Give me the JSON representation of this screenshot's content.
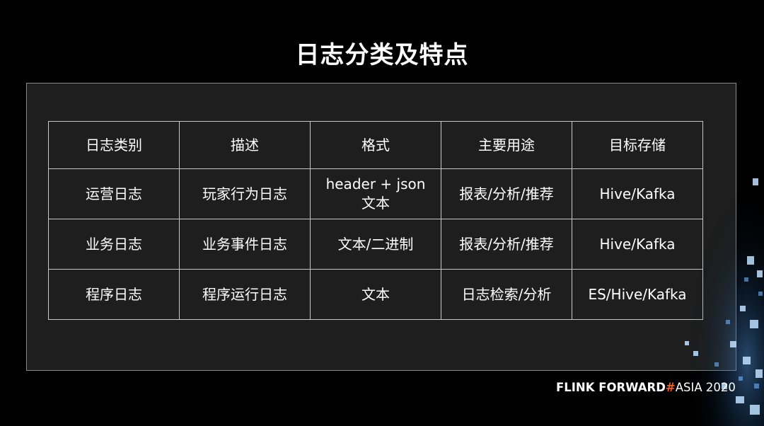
{
  "slide": {
    "title": "日志分类及特点"
  },
  "table": {
    "headers": [
      "日志类别",
      "描述",
      "格式",
      "主要用途",
      "目标存储"
    ],
    "rows": [
      [
        "运营日志",
        "玩家行为日志",
        "header + json\n文本",
        "报表/分析/推荐",
        "Hive/Kafka"
      ],
      [
        "业务日志",
        "业务事件日志",
        "文本/二进制",
        "报表/分析/推荐",
        "Hive/Kafka"
      ],
      [
        "程序日志",
        "程序运行日志",
        "文本",
        "日志检索/分析",
        "ES/Hive/Kafka"
      ]
    ]
  },
  "footer": {
    "brand_main": "FLINK  FORWARD",
    "brand_hash": "#",
    "brand_suffix": "ASIA 2020",
    "hash_color": "#e8622c"
  }
}
